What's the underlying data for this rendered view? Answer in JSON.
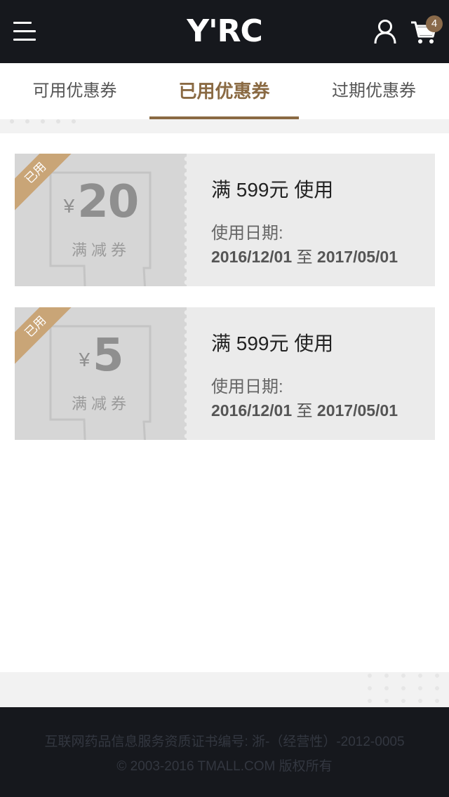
{
  "header": {
    "logo": "Y'RC",
    "cart_count": "4"
  },
  "tabs": [
    {
      "label": "可用优惠券"
    },
    {
      "label": "已用优惠券",
      "active": true
    },
    {
      "label": "过期优惠券"
    }
  ],
  "coupons": [
    {
      "ribbon": "已用",
      "currency": "¥",
      "amount": "20",
      "kind": "满减券",
      "condition": "满 599元 使用",
      "date_label": "使用日期:",
      "date_start": "2016/12/01",
      "date_sep": "至",
      "date_end": "2017/05/01"
    },
    {
      "ribbon": "已用",
      "currency": "¥",
      "amount": "5",
      "kind": "满减券",
      "condition": "满 599元 使用",
      "date_label": "使用日期:",
      "date_start": "2016/12/01",
      "date_sep": "至",
      "date_end": "2017/05/01"
    }
  ],
  "footer": {
    "license": "互联网药品信息服务资质证书编号: 浙-（经营性）-2012-0005",
    "copyright": "© 2003-2016 TMALL.COM 版权所有"
  },
  "colors": {
    "header_bg": "#16181d",
    "accent": "#8a6a43",
    "ribbon": "#c9a577",
    "badge": "#8a6a4a"
  }
}
